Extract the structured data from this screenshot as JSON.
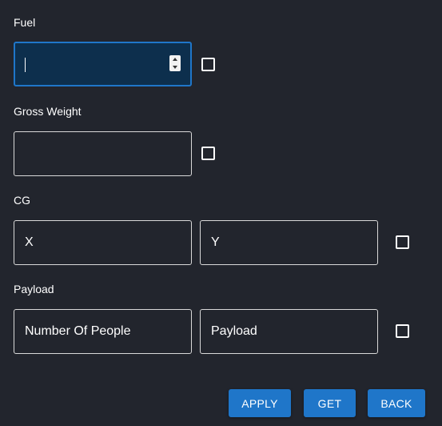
{
  "fuel": {
    "label": "Fuel",
    "value": "",
    "checked": false
  },
  "gross_weight": {
    "label": "Gross Weight",
    "value": "",
    "checked": false
  },
  "cg": {
    "label": "CG",
    "x_placeholder": "X",
    "y_placeholder": "Y",
    "checked": false
  },
  "payload": {
    "label": "Payload",
    "people_placeholder": "Number Of People",
    "payload_placeholder": "Payload",
    "checked": false
  },
  "buttons": {
    "apply": "APPLY",
    "get": "GET",
    "back": "BACK"
  },
  "colors": {
    "background": "#22252d",
    "accent": "#1f76c9",
    "focused_field_bg": "#0d2f4d"
  }
}
